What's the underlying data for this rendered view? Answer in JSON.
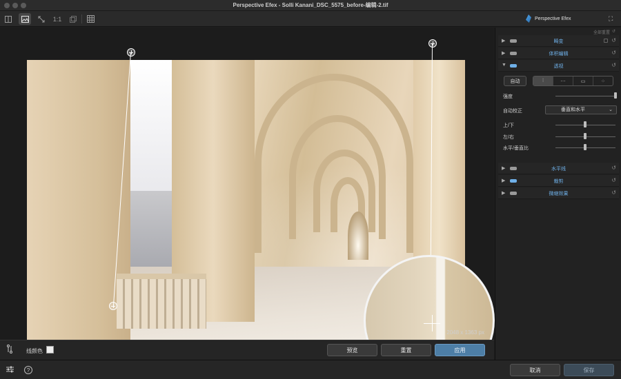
{
  "window": {
    "title": "Perspective Efex - Solli Kanani_DSC_5575_before-编辑-2.tif"
  },
  "toolbar": {
    "zoom_label": "1:1",
    "brand_name": "Perspective Efex",
    "icons": [
      "compare-icon",
      "image-view-icon",
      "fit-screen-icon",
      "zoom-1-1",
      "overlay-icon",
      "grid-icon"
    ]
  },
  "canvas": {
    "image_dimensions": "2048 x 1363 px"
  },
  "action_bar": {
    "line_color_label": "线颜色",
    "line_color": "#eeeeee",
    "preview_label": "预览",
    "reset_label": "重置",
    "apply_label": "应用"
  },
  "footer": {
    "cancel_label": "取消",
    "save_label": "保存"
  },
  "panel": {
    "reset_all_label": "全部重置",
    "sections": [
      {
        "name": "畸变",
        "expanded": false
      },
      {
        "name": "体积编辑",
        "expanded": false
      },
      {
        "name": "透视",
        "expanded": true
      },
      {
        "name": "水平线",
        "expanded": false
      },
      {
        "name": "裁剪",
        "expanded": false
      },
      {
        "name": "微缩效果",
        "expanded": false
      }
    ],
    "perspective": {
      "auto_label": "自动",
      "strength_label": "强度",
      "strength_value": 1.0,
      "auto_correct_label": "自动校正",
      "auto_correct_value": "垂直和水平",
      "up_down_label": "上/下",
      "up_down_value": 0.5,
      "left_right_label": "左/右",
      "left_right_value": 0.5,
      "ratio_label": "水平/垂直比",
      "ratio_value": 0.5
    }
  },
  "colors": {
    "accent": "#6fb0e8",
    "apply_button": "#4d7ea6"
  }
}
